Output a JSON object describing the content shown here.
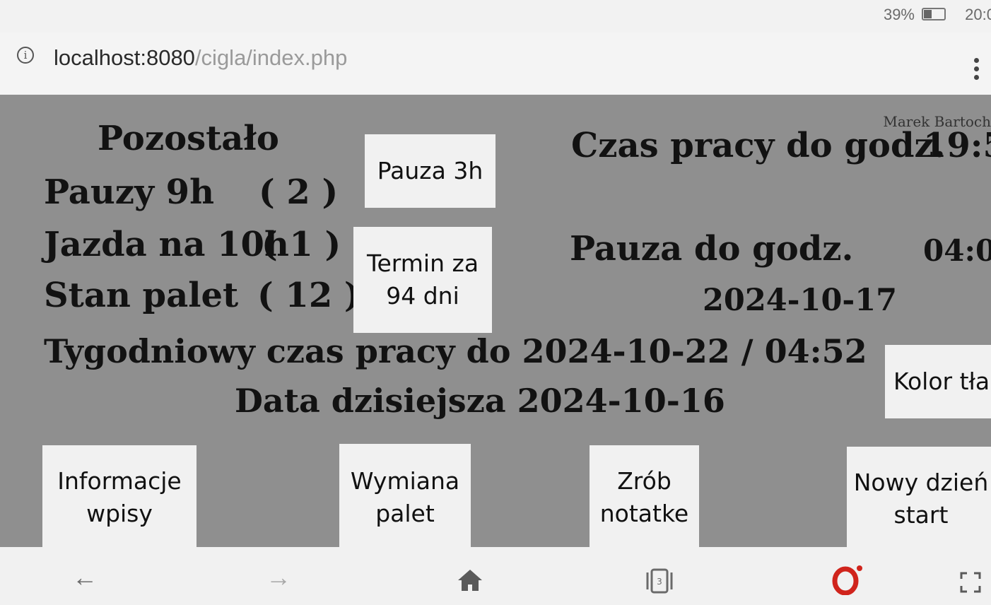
{
  "status_bar": {
    "battery_percent": "39%",
    "battery_level": 0.39,
    "time": "20:0"
  },
  "browser": {
    "url_host": "localhost:8080",
    "url_path": "/cigla/index.php",
    "tab_count": "3"
  },
  "page": {
    "user_name": "Marek Bartoch",
    "remaining_label": "Pozostało",
    "breaks_9h_label": "Pauzy 9h",
    "breaks_9h_count": "( 2 )",
    "driving_10h_label": "Jazda na 10h",
    "driving_10h_count": "( 1 )",
    "pallets_label": "Stan palet",
    "pallets_count": "( 12 )",
    "work_time_label": "Czas pracy do godz.",
    "work_time_value": "19:5",
    "break_until_label": "Pauza do godz.",
    "break_until_value": "04:0",
    "break_until_date": "2024-10-17",
    "weekly_text": "Tygodniowy czas pracy do 2024-10-22 / 04:52",
    "today_text": "Data dzisiejsza 2024-10-16"
  },
  "buttons": {
    "pause_3h": "Pauza 3h",
    "deadline_line1": "Termin za",
    "deadline_line2": "94 dni",
    "background_color": "Kolor tła",
    "info_line1": "Informacje",
    "info_line2": "wpisy",
    "pallets_line1": "Wymiana",
    "pallets_line2": "palet",
    "note_line1": "Zrób",
    "note_line2": "notatke",
    "newday_line1": "Nowy dzień",
    "newday_line2": "start"
  },
  "colors": {
    "page_background": "#8f8f8f",
    "button_background": "#f1f1f1",
    "opera_red": "#d0241c"
  },
  "icons": {
    "back": "arrow-left-icon",
    "forward": "arrow-right-icon",
    "home": "home-icon",
    "tabs": "tabs-icon",
    "opera": "opera-logo-icon",
    "fullscreen": "fullscreen-icon"
  }
}
